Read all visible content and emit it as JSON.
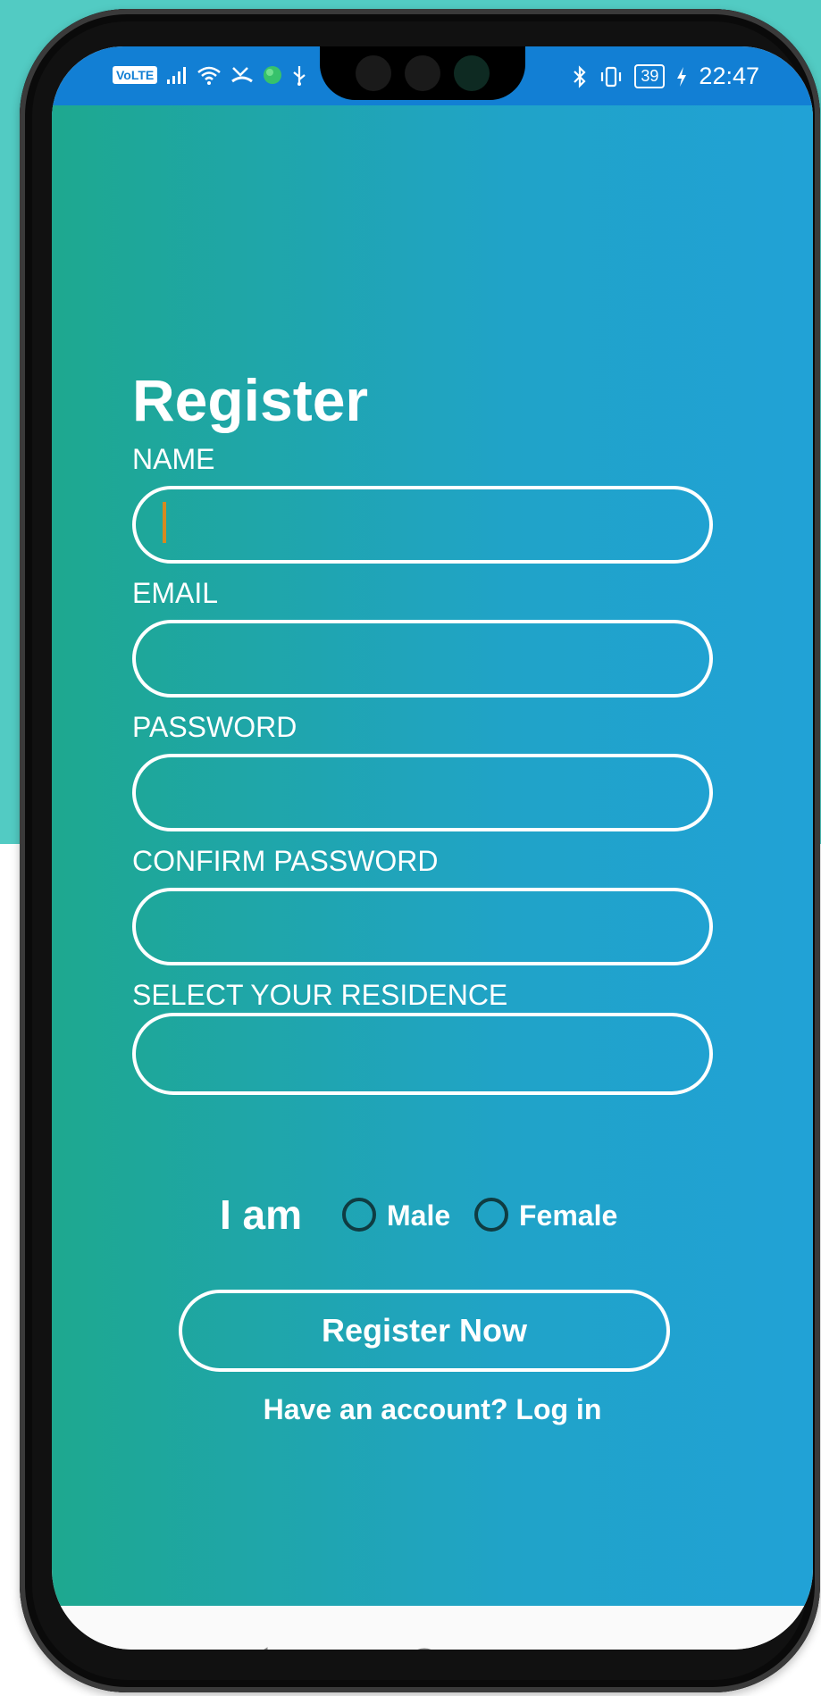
{
  "status_bar": {
    "volte": "VoLTE",
    "signal_icon": "signal-bars-icon",
    "wifi_icon": "wifi-icon",
    "missed_call_icon": "missed-call-icon",
    "app_icon": "globe-app-icon",
    "usb_icon": "usb-icon",
    "bluetooth_icon": "bluetooth-icon",
    "vibrate_icon": "vibrate-icon",
    "battery": "39",
    "charging_icon": "charging-bolt-icon",
    "time": "22:47"
  },
  "form": {
    "title": "Register",
    "name_label": "NAME",
    "email_label": "EMAIL",
    "password_label": "PASSWORD",
    "confirm_password_label": "CONFIRM PASSWORD",
    "residence_label": "SELECT YOUR RESIDENCE",
    "name_value": "",
    "email_value": "",
    "password_value": "",
    "confirm_password_value": "",
    "residence_value": ""
  },
  "gender": {
    "label": "I am",
    "options": [
      "Male",
      "Female"
    ],
    "selected": null
  },
  "actions": {
    "register_button": "Register Now",
    "login_link": "Have an account? Log in"
  },
  "colors": {
    "status_bar": "#127fd4",
    "gradient_start": "#1ea88f",
    "gradient_end": "#21a2d6",
    "cursor": "#d58a20",
    "radio_border": "#0f3c42"
  },
  "nav": {
    "back_icon": "back-triangle-icon",
    "home_icon": "home-circle-icon",
    "recents_icon": "recents-square-icon"
  }
}
